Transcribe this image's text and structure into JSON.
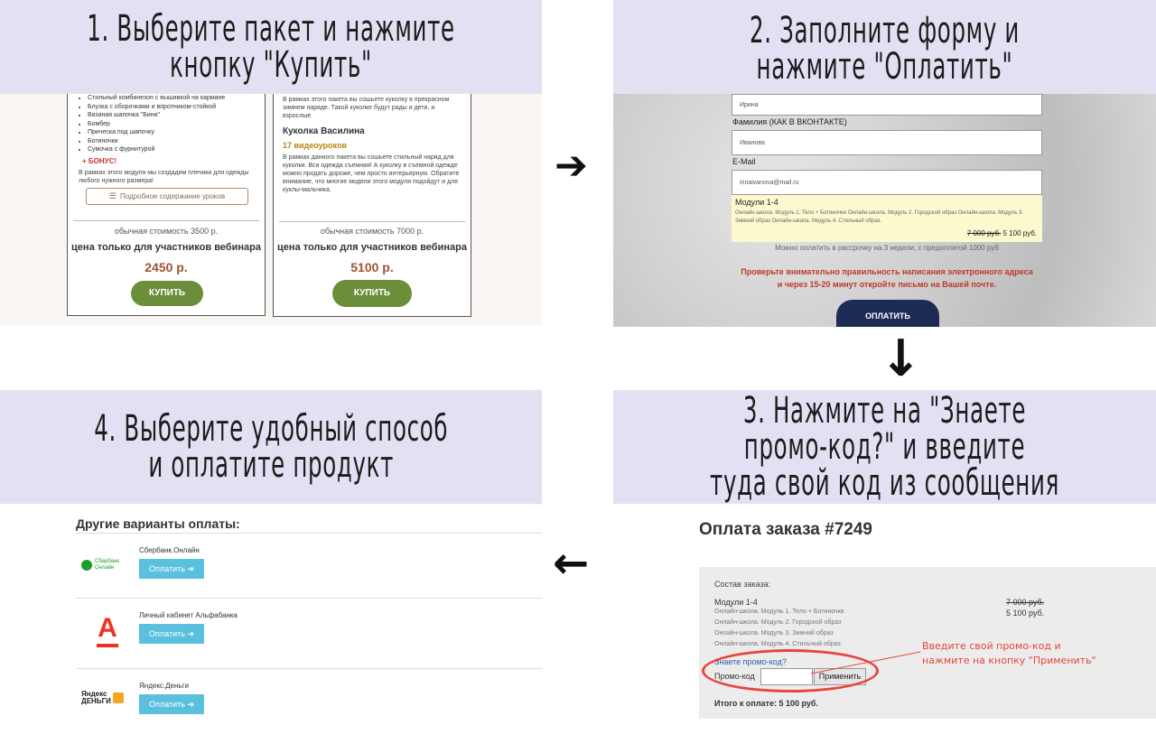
{
  "steps": {
    "step1": "1. Выберите пакет и нажмите кнопку \"Купить\"",
    "step2": "2. Заполните форму и нажмите \"Оплатить\"",
    "step3": "3. Нажмите на \"Знаете промо-код?\" и введите\nтуда свой код из сообщения",
    "step4": "4. Выберите удобный способ\nи оплатите продукт"
  },
  "arrows": {
    "right": "➔",
    "down": "↓",
    "left": "←"
  },
  "panel1": {
    "card1": {
      "items": [
        "Стильный комбинезон с вышивкой на кармане",
        "Блузка с оборочками и воротником-стойкой",
        "Вязаная шапочка \"Бини\"",
        "Бомбер",
        "Прическа под шапочку",
        "Ботиночки",
        "Сумочка с фурнитурой"
      ],
      "bonus": "+ БОНУС!",
      "bonus_text": "В рамках этого модуля мы создадим плечики для одежды любого нужного размера!",
      "details_button": "Подробное содержание уроков",
      "old_price": "обычная стоимость 3500 р.",
      "promo_line": "цена только для участников вебинара",
      "price": "2450 р.",
      "buy": "КУПИТЬ"
    },
    "card2": {
      "intro": "В рамках этого пакета вы сошьете куколку в прекрасном зимнем наряде. Такой куколке будут рады и дети, и взрослые.",
      "title": "Куколка Василина",
      "lessons": "17 видеоуроков",
      "desc": "В рамках данного пакета вы сошьете стильный наряд для куколки. Вся одежда съемная! А куколку в съемной одежде можно продать дороже, чем просто интерьерную. Обратите внимание, что многие модели этого модуля подойдут и для куклы-мальчика.",
      "old_price": "обычная стоимость 7000 р.",
      "promo_line": "цена только для участников вебинара",
      "price": "5100 р.",
      "buy": "КУПИТЬ"
    }
  },
  "panel2": {
    "name_value": "Ирина",
    "surname_label": "Фамилия (КАК В ВКОНТАКТЕ)",
    "surname_value": "Иванова",
    "email_label": "E-Mail",
    "email_value": "irinaivanova@mail.ru",
    "module_title": "Модули 1-4",
    "module_desc": "Онлайн-школа. Модуль 1. Тело + Ботиночки Онлайн-школа. Модуль 2. Городской образ Онлайн-школа. Модуль 3. Зимний образ Онлайн-школа. Модуль 4. Стильный образ.",
    "old_price": "7 000 руб.",
    "new_price": "5 100 руб.",
    "installment": "Можно оплатить в рассрочку на 3 недели, с предоплатой 1000 руб",
    "warning": "Проверьте внимательно правильность написания электронного адреса и через 15-20 минут откройте письмо на Вашей почте.",
    "pay_button": "ОПЛАТИТЬ"
  },
  "panel3": {
    "heading": "Оплата заказа #7249",
    "order_label": "Состав заказа:",
    "item_title": "Модули 1-4",
    "item_lines": [
      "Онлайн-школа. Модуль 1. Тело + Ботиночки",
      "Онлайн-школа. Модуль 2. Городской образ",
      "Онлайн-школа. Модуль 3. Зимний образ",
      "Онлайн-школа. Модуль 4. Стильный образ."
    ],
    "old_price": "7 000 руб.",
    "new_price": "5 100 руб.",
    "promo_link": "Знаете промо-код?",
    "promo_label": "Промо-код",
    "apply": "Применить",
    "total": "Итого к оплате: 5 100 руб.",
    "annotation": "Введите свой промо-код и\nнажмите на кнопку \"Применить\"",
    "annotation_color": "#e8453c"
  },
  "panel4": {
    "heading": "Другие варианты оплаты:",
    "methods": [
      {
        "name": "Сбербанк.Онлайн",
        "logo": "Сбербанк\nОнлайн",
        "button": "Оплатить"
      },
      {
        "name": "Личный кабинет Альфабанка",
        "logo": "А",
        "button": "Оплатить"
      },
      {
        "name": "Яндекс.Деньги",
        "logo": "Яндекс\nДЕНЬГИ",
        "button": "Оплатить"
      }
    ]
  },
  "colors": {
    "title_bg": "#e3e0f3",
    "buy_green": "#6b8e3a",
    "pay_navy": "#1c2c55",
    "pay_blue": "#5bc0de",
    "price_brown": "#a0522d",
    "alfa_red": "#ef3124",
    "sber_green": "#1a9f29"
  }
}
